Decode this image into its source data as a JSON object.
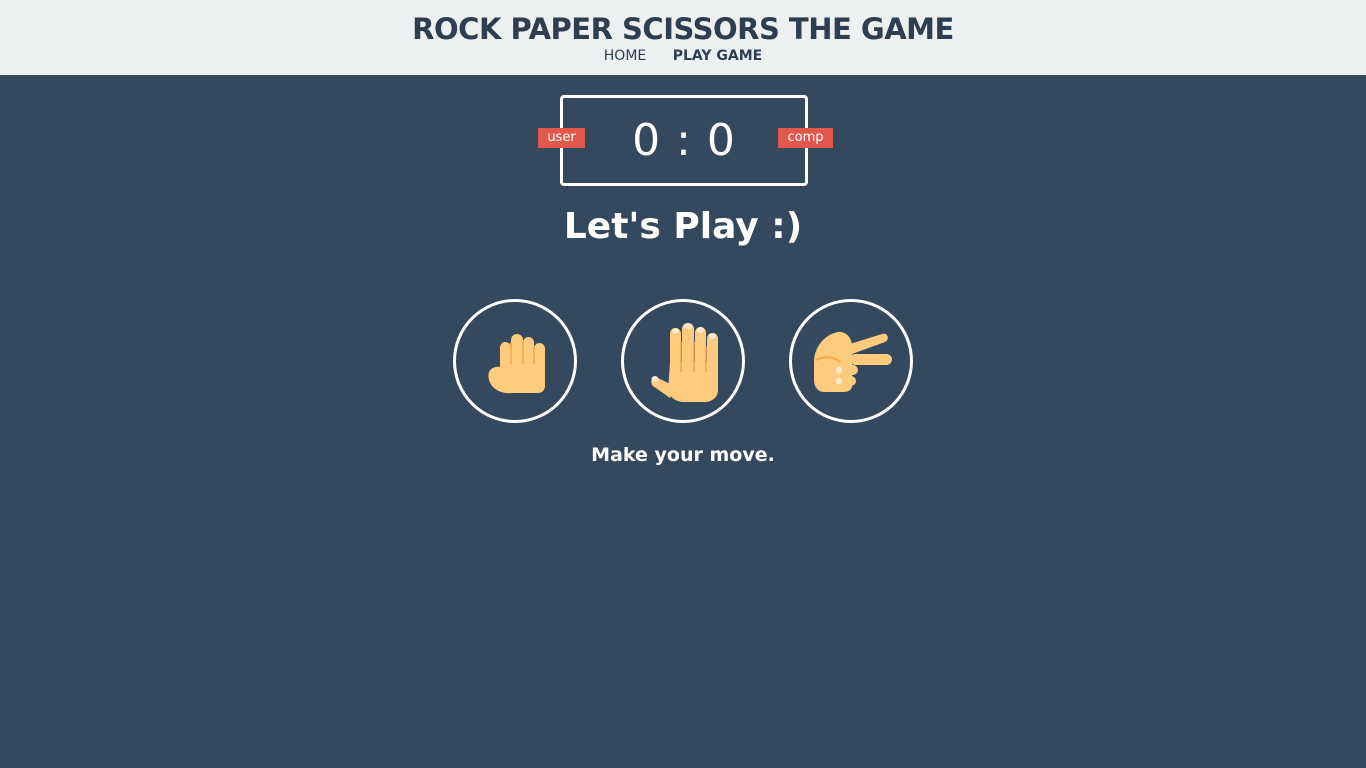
{
  "header": {
    "title": "ROCK PAPER SCISSORS THE GAME",
    "nav": [
      {
        "label": "HOME",
        "active": false
      },
      {
        "label": "PLAY GAME",
        "active": true
      }
    ]
  },
  "scoreboard": {
    "user_label": "user",
    "comp_label": "comp",
    "user_score": 0,
    "comp_score": 0,
    "score_text": "0 : 0"
  },
  "result": {
    "message": "Let's Play :)"
  },
  "choices": [
    {
      "name": "rock",
      "icon": "fist-icon"
    },
    {
      "name": "paper",
      "icon": "open-hand-icon"
    },
    {
      "name": "scissors",
      "icon": "peace-hand-icon"
    }
  ],
  "action_message": "Make your move.",
  "colors": {
    "header_bg": "#ecf0f1",
    "page_bg": "#34495e",
    "title": "#2c3e50",
    "badge": "#e2584d",
    "skin": "#fdcb7e",
    "skin_shadow": "#f2a94b",
    "nail": "#fde9d0"
  }
}
